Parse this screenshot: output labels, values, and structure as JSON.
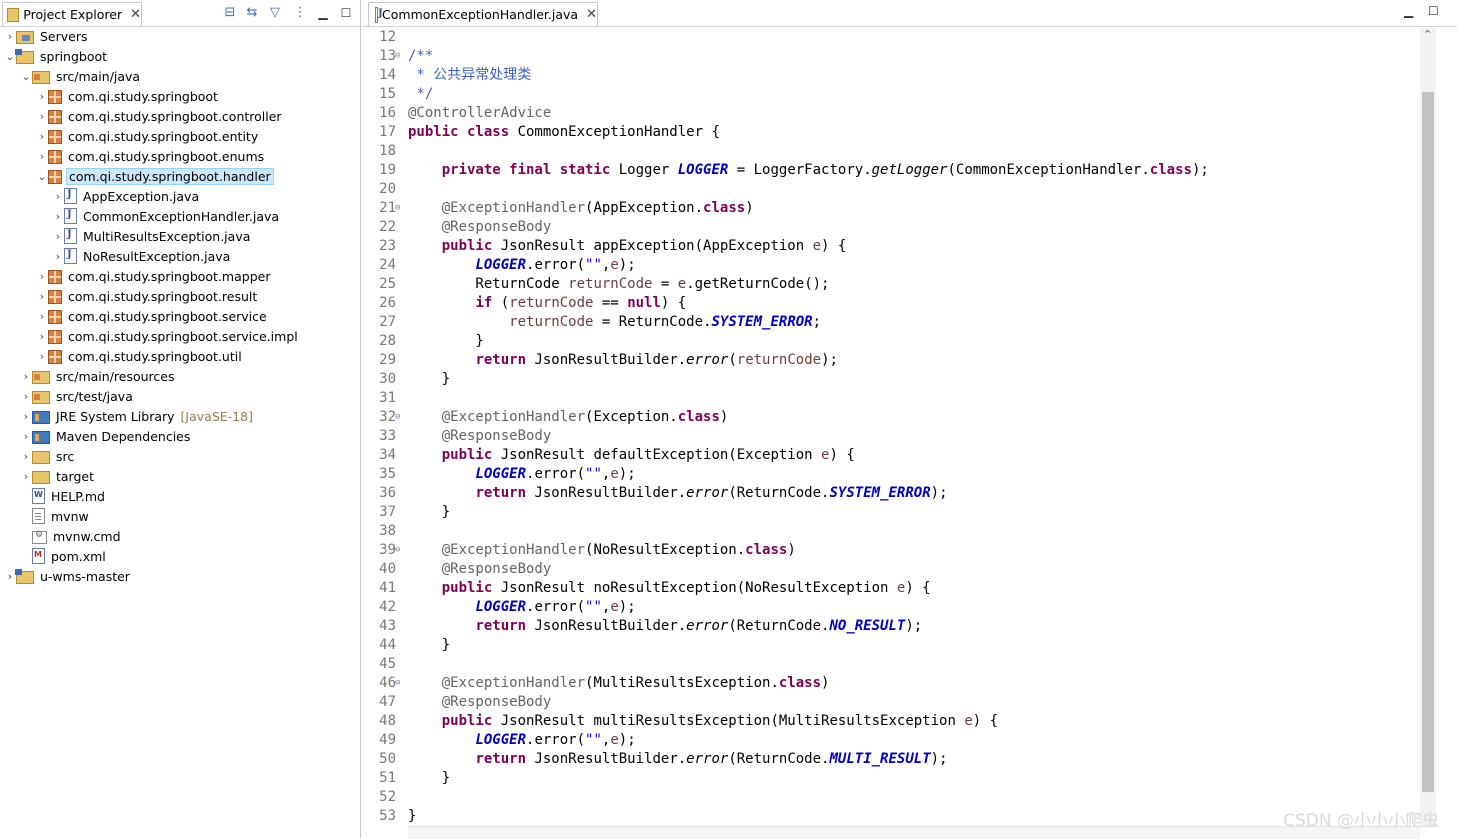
{
  "explorer": {
    "tab_title": "Project Explorer",
    "close_glyph": "✕",
    "tree": [
      {
        "label": "Servers",
        "level": 0,
        "arrow": "›",
        "icon": "servers-icon"
      },
      {
        "label": "springboot",
        "level": 0,
        "arrow": "⌄",
        "icon": "project-icon"
      },
      {
        "label": "src/main/java",
        "level": 1,
        "arrow": "⌄",
        "icon": "source-folder-icon"
      },
      {
        "label": "com.qi.study.springboot",
        "level": 2,
        "arrow": "›",
        "icon": "package-icon"
      },
      {
        "label": "com.qi.study.springboot.controller",
        "level": 2,
        "arrow": "›",
        "icon": "package-icon"
      },
      {
        "label": "com.qi.study.springboot.entity",
        "level": 2,
        "arrow": "›",
        "icon": "package-icon"
      },
      {
        "label": "com.qi.study.springboot.enums",
        "level": 2,
        "arrow": "›",
        "icon": "package-icon"
      },
      {
        "label": "com.qi.study.springboot.handler",
        "level": 2,
        "arrow": "⌄",
        "icon": "package-icon",
        "selected": true
      },
      {
        "label": "AppException.java",
        "level": 3,
        "arrow": "›",
        "icon": "java-file-icon"
      },
      {
        "label": "CommonExceptionHandler.java",
        "level": 3,
        "arrow": "›",
        "icon": "java-file-icon"
      },
      {
        "label": "MultiResultsException.java",
        "level": 3,
        "arrow": "›",
        "icon": "java-file-icon"
      },
      {
        "label": "NoResultException.java",
        "level": 3,
        "arrow": "›",
        "icon": "java-file-icon"
      },
      {
        "label": "com.qi.study.springboot.mapper",
        "level": 2,
        "arrow": "›",
        "icon": "package-icon"
      },
      {
        "label": "com.qi.study.springboot.result",
        "level": 2,
        "arrow": "›",
        "icon": "package-icon"
      },
      {
        "label": "com.qi.study.springboot.service",
        "level": 2,
        "arrow": "›",
        "icon": "package-icon"
      },
      {
        "label": "com.qi.study.springboot.service.impl",
        "level": 2,
        "arrow": "›",
        "icon": "package-icon"
      },
      {
        "label": "com.qi.study.springboot.util",
        "level": 2,
        "arrow": "›",
        "icon": "package-icon"
      },
      {
        "label": "src/main/resources",
        "level": 1,
        "arrow": "›",
        "icon": "source-folder-icon"
      },
      {
        "label": "src/test/java",
        "level": 1,
        "arrow": "›",
        "icon": "source-folder-icon"
      },
      {
        "label": "JRE System Library",
        "decoration": "[JavaSE-18]",
        "level": 1,
        "arrow": "›",
        "icon": "library-icon"
      },
      {
        "label": "Maven Dependencies",
        "level": 1,
        "arrow": "›",
        "icon": "library-icon"
      },
      {
        "label": "src",
        "level": 1,
        "arrow": "›",
        "icon": "folder-icon"
      },
      {
        "label": "target",
        "level": 1,
        "arrow": "›",
        "icon": "folder-icon"
      },
      {
        "label": "HELP.md",
        "level": 1,
        "arrow": "",
        "icon": "markdown-file-icon"
      },
      {
        "label": "mvnw",
        "level": 1,
        "arrow": "",
        "icon": "text-file-icon"
      },
      {
        "label": "mvnw.cmd",
        "level": 1,
        "arrow": "",
        "icon": "cmd-file-icon"
      },
      {
        "label": "pom.xml",
        "level": 1,
        "arrow": "",
        "icon": "pom-file-icon"
      },
      {
        "label": "u-wms-master",
        "level": 0,
        "arrow": "›",
        "icon": "project-icon"
      }
    ]
  },
  "editor": {
    "tab_title": "CommonExceptionHandler.java",
    "close_glyph": "✕",
    "lines": [
      {
        "n": "12",
        "fold": false,
        "t": []
      },
      {
        "n": "13",
        "fold": true,
        "t": [
          [
            "cmt",
            "/**"
          ]
        ]
      },
      {
        "n": "14",
        "fold": false,
        "t": [
          [
            "cmt",
            " * 公共异常处理类"
          ]
        ]
      },
      {
        "n": "15",
        "fold": false,
        "t": [
          [
            "cmt",
            " */"
          ]
        ]
      },
      {
        "n": "16",
        "fold": false,
        "t": [
          [
            "ann",
            "@ControllerAdvice"
          ]
        ]
      },
      {
        "n": "17",
        "fold": false,
        "t": [
          [
            "kw",
            "public class "
          ],
          [
            "",
            "CommonExceptionHandler {"
          ]
        ]
      },
      {
        "n": "18",
        "fold": false,
        "t": []
      },
      {
        "n": "19",
        "fold": false,
        "t": [
          [
            "",
            "    "
          ],
          [
            "kw",
            "private final static "
          ],
          [
            "",
            "Logger "
          ],
          [
            "fld",
            "LOGGER"
          ],
          [
            "",
            " = LoggerFactory."
          ],
          [
            "mth-s",
            "getLogger"
          ],
          [
            "",
            "(CommonExceptionHandler."
          ],
          [
            "kw",
            "class"
          ],
          [
            "",
            ");"
          ]
        ]
      },
      {
        "n": "20",
        "fold": false,
        "t": []
      },
      {
        "n": "21",
        "fold": true,
        "t": [
          [
            "",
            "    "
          ],
          [
            "ann",
            "@ExceptionHandler"
          ],
          [
            "",
            "(AppException."
          ],
          [
            "kw",
            "class"
          ],
          [
            "",
            ")"
          ]
        ]
      },
      {
        "n": "22",
        "fold": false,
        "t": [
          [
            "",
            "    "
          ],
          [
            "ann",
            "@ResponseBody"
          ]
        ]
      },
      {
        "n": "23",
        "fold": false,
        "t": [
          [
            "",
            "    "
          ],
          [
            "kw",
            "public "
          ],
          [
            "",
            "JsonResult appException(AppException "
          ],
          [
            "var",
            "e"
          ],
          [
            "",
            ") {"
          ]
        ]
      },
      {
        "n": "24",
        "fold": false,
        "t": [
          [
            "",
            "        "
          ],
          [
            "fld",
            "LOGGER"
          ],
          [
            "",
            ".error("
          ],
          [
            "str",
            "\"\""
          ],
          [
            "",
            ","
          ],
          [
            "var",
            "e"
          ],
          [
            "",
            ");"
          ]
        ]
      },
      {
        "n": "25",
        "fold": false,
        "t": [
          [
            "",
            "        ReturnCode "
          ],
          [
            "var",
            "returnCode"
          ],
          [
            "",
            " = "
          ],
          [
            "var",
            "e"
          ],
          [
            "",
            ".getReturnCode();"
          ]
        ]
      },
      {
        "n": "26",
        "fold": false,
        "t": [
          [
            "",
            "        "
          ],
          [
            "kw",
            "if "
          ],
          [
            "",
            "("
          ],
          [
            "var",
            "returnCode"
          ],
          [
            "",
            " == "
          ],
          [
            "kw",
            "null"
          ],
          [
            "",
            ") {"
          ]
        ]
      },
      {
        "n": "27",
        "fold": false,
        "t": [
          [
            "",
            "            "
          ],
          [
            "var",
            "returnCode"
          ],
          [
            "",
            " = ReturnCode."
          ],
          [
            "fld",
            "SYSTEM_ERROR"
          ],
          [
            "",
            ";"
          ]
        ]
      },
      {
        "n": "28",
        "fold": false,
        "t": [
          [
            "",
            "        }"
          ]
        ]
      },
      {
        "n": "29",
        "fold": false,
        "t": [
          [
            "",
            "        "
          ],
          [
            "kw",
            "return "
          ],
          [
            "",
            "JsonResultBuilder."
          ],
          [
            "mth-s",
            "error"
          ],
          [
            "",
            "("
          ],
          [
            "var",
            "returnCode"
          ],
          [
            "",
            ");"
          ]
        ]
      },
      {
        "n": "30",
        "fold": false,
        "t": [
          [
            "",
            "    }"
          ]
        ]
      },
      {
        "n": "31",
        "fold": false,
        "t": []
      },
      {
        "n": "32",
        "fold": true,
        "t": [
          [
            "",
            "    "
          ],
          [
            "ann",
            "@ExceptionHandler"
          ],
          [
            "",
            "(Exception."
          ],
          [
            "kw",
            "class"
          ],
          [
            "",
            ")"
          ]
        ]
      },
      {
        "n": "33",
        "fold": false,
        "t": [
          [
            "",
            "    "
          ],
          [
            "ann",
            "@ResponseBody"
          ]
        ]
      },
      {
        "n": "34",
        "fold": false,
        "t": [
          [
            "",
            "    "
          ],
          [
            "kw",
            "public "
          ],
          [
            "",
            "JsonResult defaultException(Exception "
          ],
          [
            "var",
            "e"
          ],
          [
            "",
            ") {"
          ]
        ]
      },
      {
        "n": "35",
        "fold": false,
        "t": [
          [
            "",
            "        "
          ],
          [
            "fld",
            "LOGGER"
          ],
          [
            "",
            ".error("
          ],
          [
            "str",
            "\"\""
          ],
          [
            "",
            ","
          ],
          [
            "var",
            "e"
          ],
          [
            "",
            ");"
          ]
        ]
      },
      {
        "n": "36",
        "fold": false,
        "t": [
          [
            "",
            "        "
          ],
          [
            "kw",
            "return "
          ],
          [
            "",
            "JsonResultBuilder."
          ],
          [
            "mth-s",
            "error"
          ],
          [
            "",
            "(ReturnCode."
          ],
          [
            "fld",
            "SYSTEM_ERROR"
          ],
          [
            "",
            ");"
          ]
        ]
      },
      {
        "n": "37",
        "fold": false,
        "t": [
          [
            "",
            "    }"
          ]
        ]
      },
      {
        "n": "38",
        "fold": false,
        "t": []
      },
      {
        "n": "39",
        "fold": true,
        "t": [
          [
            "",
            "    "
          ],
          [
            "ann",
            "@ExceptionHandler"
          ],
          [
            "",
            "(NoResultException."
          ],
          [
            "kw",
            "class"
          ],
          [
            "",
            ")"
          ]
        ]
      },
      {
        "n": "40",
        "fold": false,
        "t": [
          [
            "",
            "    "
          ],
          [
            "ann",
            "@ResponseBody"
          ]
        ]
      },
      {
        "n": "41",
        "fold": false,
        "t": [
          [
            "",
            "    "
          ],
          [
            "kw",
            "public "
          ],
          [
            "",
            "JsonResult noResultException(NoResultException "
          ],
          [
            "var",
            "e"
          ],
          [
            "",
            ") {"
          ]
        ]
      },
      {
        "n": "42",
        "fold": false,
        "t": [
          [
            "",
            "        "
          ],
          [
            "fld",
            "LOGGER"
          ],
          [
            "",
            ".error("
          ],
          [
            "str",
            "\"\""
          ],
          [
            "",
            ","
          ],
          [
            "var",
            "e"
          ],
          [
            "",
            ");"
          ]
        ]
      },
      {
        "n": "43",
        "fold": false,
        "t": [
          [
            "",
            "        "
          ],
          [
            "kw",
            "return "
          ],
          [
            "",
            "JsonResultBuilder."
          ],
          [
            "mth-s",
            "error"
          ],
          [
            "",
            "(ReturnCode."
          ],
          [
            "fld",
            "NO_RESULT"
          ],
          [
            "",
            ");"
          ]
        ]
      },
      {
        "n": "44",
        "fold": false,
        "t": [
          [
            "",
            "    }"
          ]
        ]
      },
      {
        "n": "45",
        "fold": false,
        "t": []
      },
      {
        "n": "46",
        "fold": true,
        "t": [
          [
            "",
            "    "
          ],
          [
            "ann",
            "@ExceptionHandler"
          ],
          [
            "",
            "(MultiResultsException."
          ],
          [
            "kw",
            "class"
          ],
          [
            "",
            ")"
          ]
        ]
      },
      {
        "n": "47",
        "fold": false,
        "t": [
          [
            "",
            "    "
          ],
          [
            "ann",
            "@ResponseBody"
          ]
        ]
      },
      {
        "n": "48",
        "fold": false,
        "t": [
          [
            "",
            "    "
          ],
          [
            "kw",
            "public "
          ],
          [
            "",
            "JsonResult multiResultsException(MultiResultsException "
          ],
          [
            "var",
            "e"
          ],
          [
            "",
            ") {"
          ]
        ]
      },
      {
        "n": "49",
        "fold": false,
        "t": [
          [
            "",
            "        "
          ],
          [
            "fld",
            "LOGGER"
          ],
          [
            "",
            ".error("
          ],
          [
            "str",
            "\"\""
          ],
          [
            "",
            ","
          ],
          [
            "var",
            "e"
          ],
          [
            "",
            ");"
          ]
        ]
      },
      {
        "n": "50",
        "fold": false,
        "t": [
          [
            "",
            "        "
          ],
          [
            "kw",
            "return "
          ],
          [
            "",
            "JsonResultBuilder."
          ],
          [
            "mth-s",
            "error"
          ],
          [
            "",
            "(ReturnCode."
          ],
          [
            "fld",
            "MULTI_RESULT"
          ],
          [
            "",
            ");"
          ]
        ]
      },
      {
        "n": "51",
        "fold": false,
        "t": [
          [
            "",
            "    }"
          ]
        ]
      },
      {
        "n": "52",
        "fold": false,
        "t": []
      },
      {
        "n": "53",
        "fold": false,
        "t": [
          [
            "",
            "}"
          ]
        ]
      }
    ]
  },
  "watermark": "CSDN @小小小爬虫"
}
